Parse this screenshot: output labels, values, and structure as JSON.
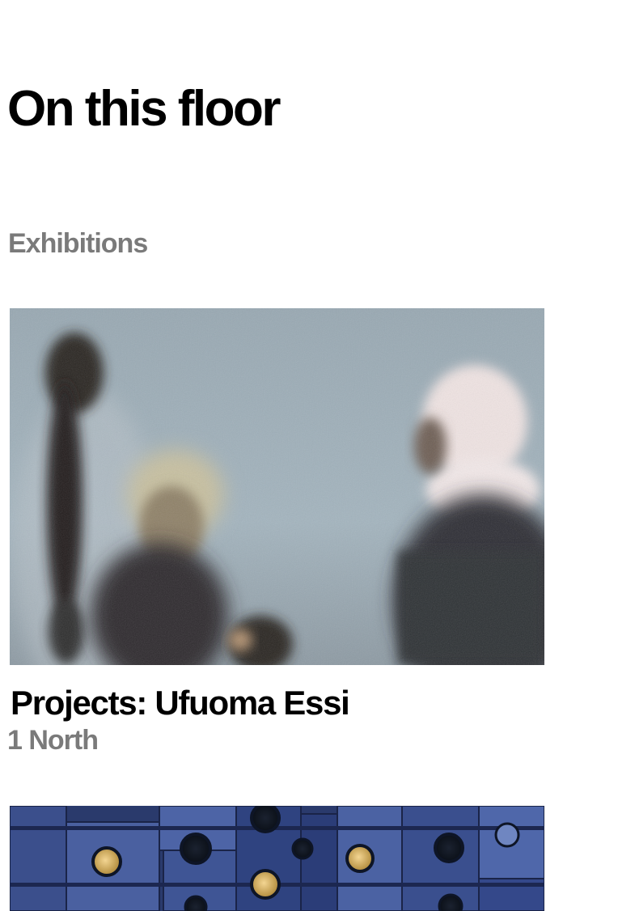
{
  "page": {
    "title": "On this floor"
  },
  "sections": [
    {
      "heading": "Exhibitions",
      "items": [
        {
          "title": "Projects: Ufuoma Essi",
          "location": "1 North",
          "image_icon": "film-still-photo"
        },
        {
          "title": "",
          "location": "",
          "image_icon": "capsule-tower-photo"
        }
      ]
    }
  ]
}
